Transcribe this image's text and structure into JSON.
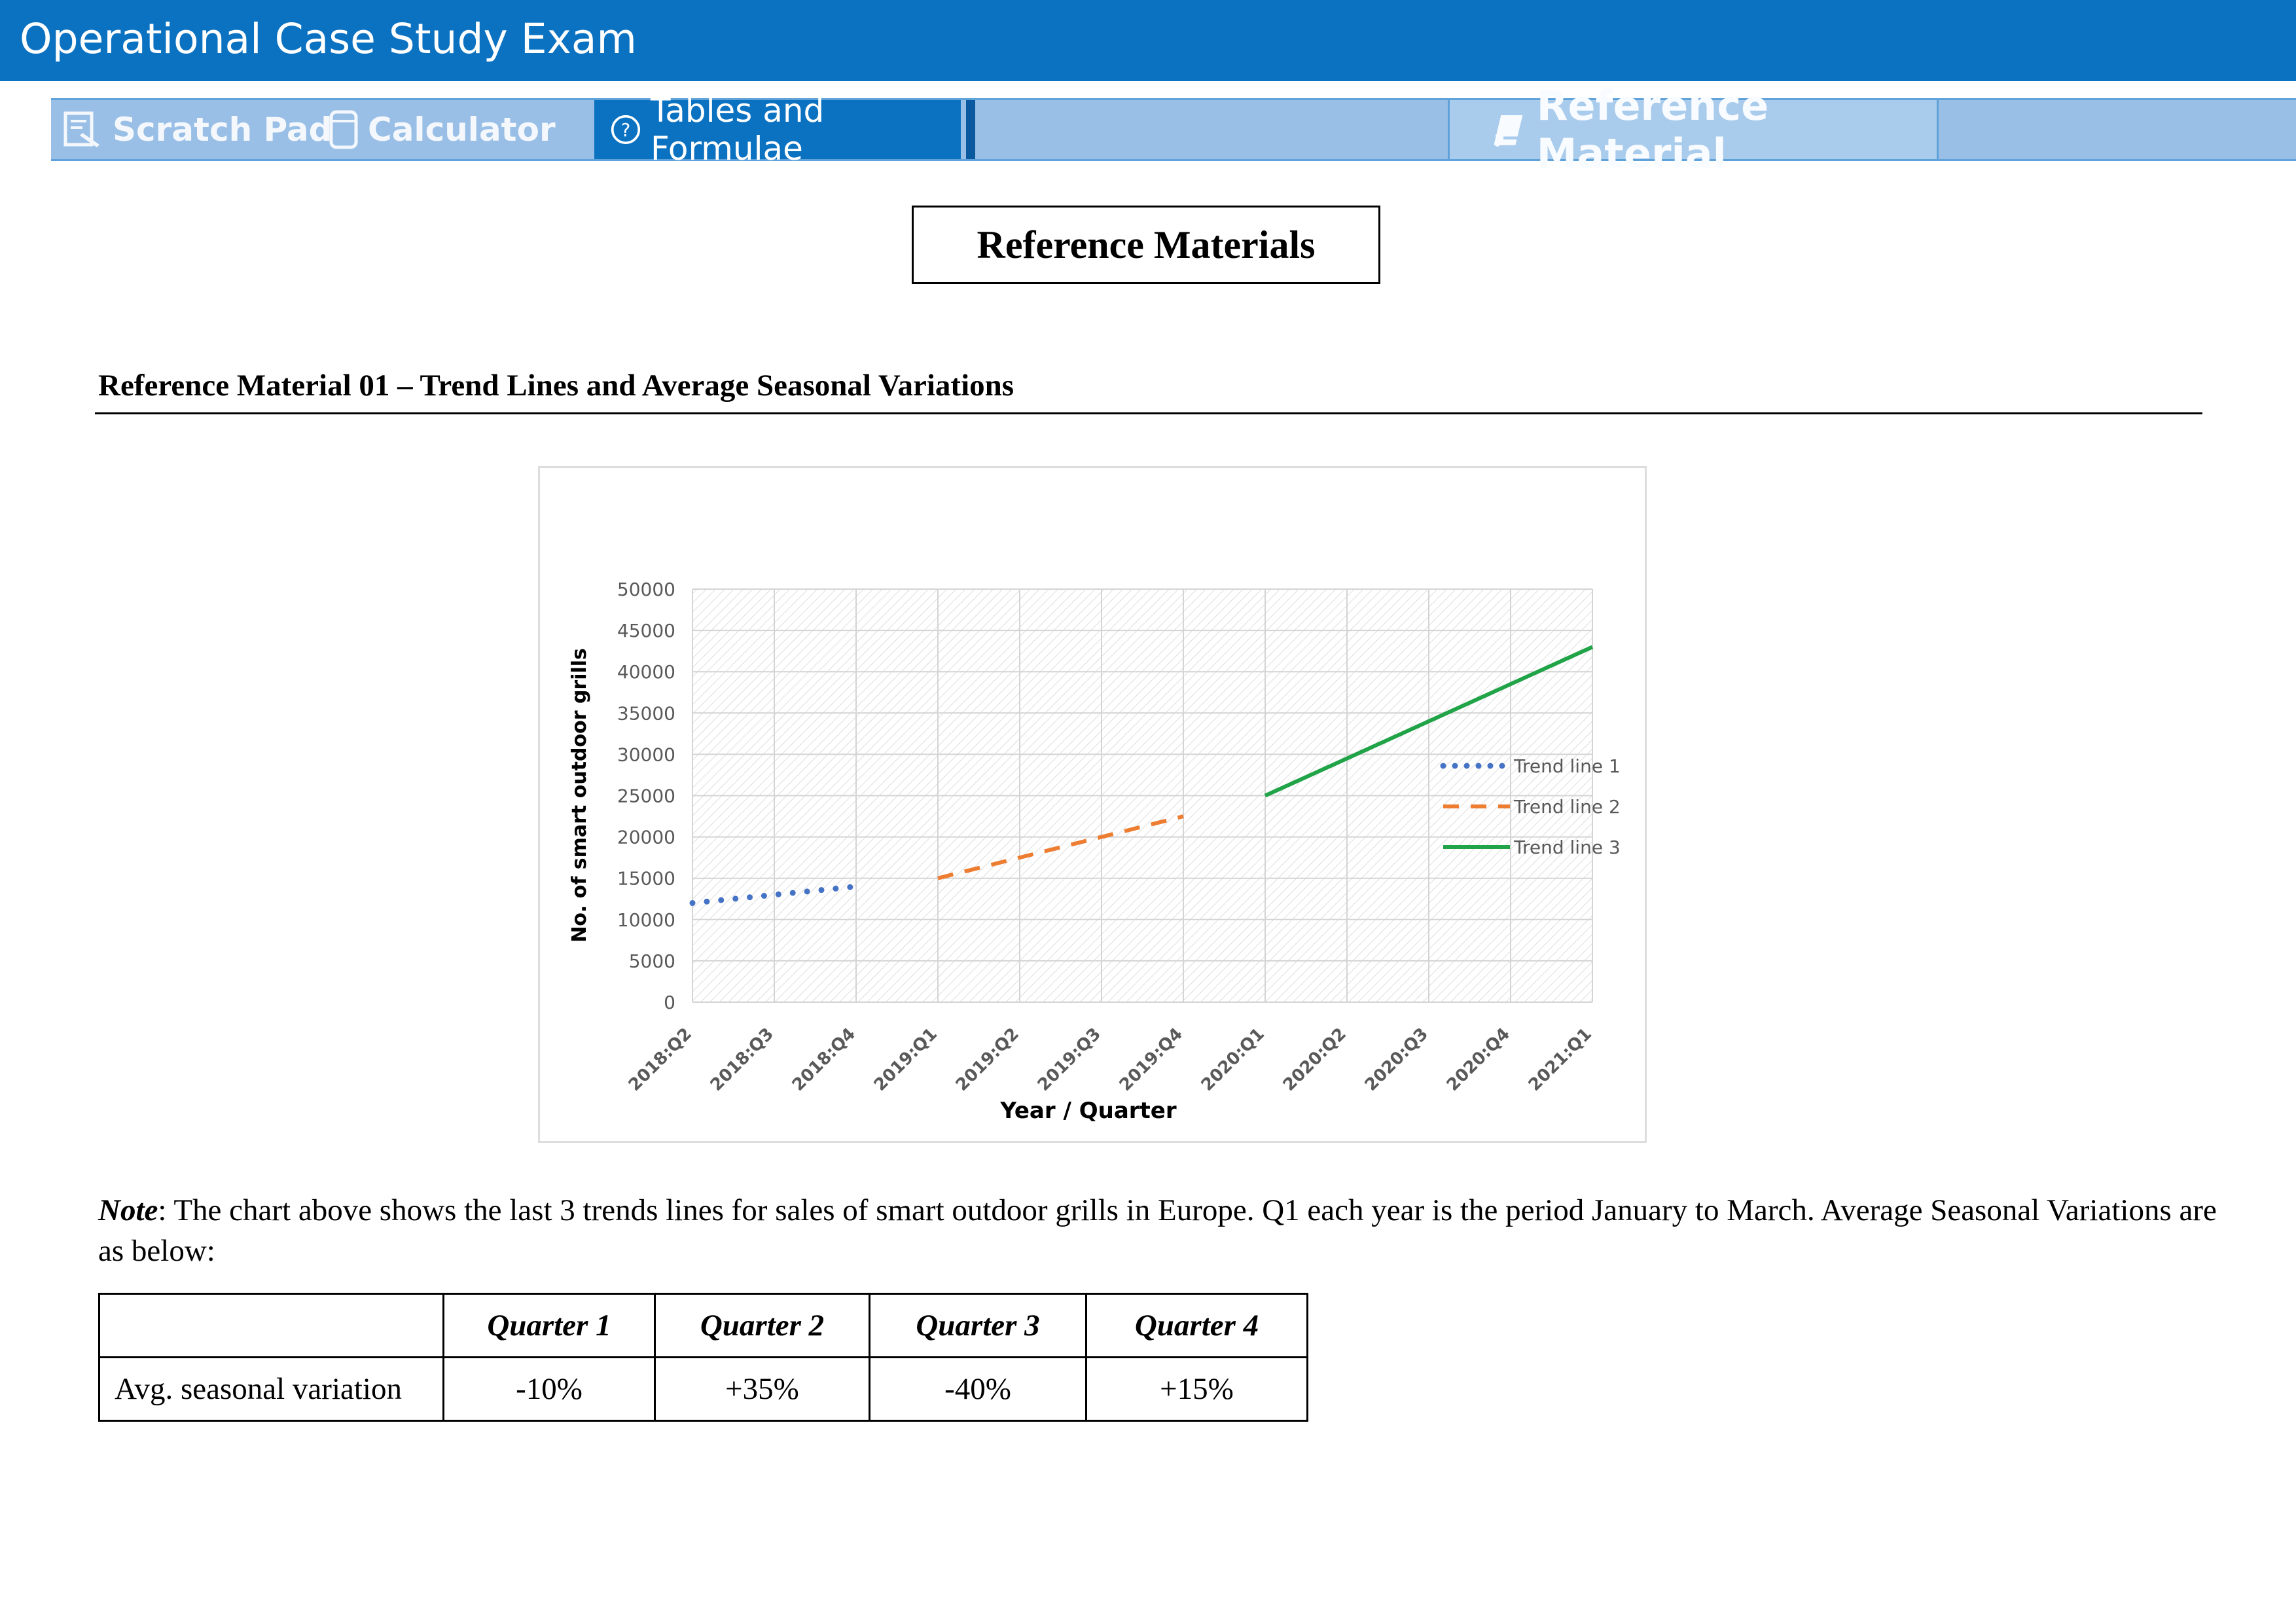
{
  "window": {
    "title": "Operational Case Study Exam"
  },
  "toolbar": {
    "scratch_pad": "Scratch Pad",
    "calculator": "Calculator",
    "tables_formulae": "Tables and Formulae",
    "reference_material": "Reference Material"
  },
  "page": {
    "heading": "Reference Materials",
    "section_title": "Reference Material 01 – Trend Lines and Average Seasonal Variations",
    "note_label": "Note",
    "note_text": ": The chart above shows the last 3 trends lines for sales of smart outdoor grills in Europe. Q1 each year is the period January to March. Average Seasonal Variations are as below:"
  },
  "table": {
    "headers": [
      "",
      "Quarter 1",
      "Quarter 2",
      "Quarter 3",
      "Quarter 4"
    ],
    "rows": [
      {
        "label": "Avg. seasonal variation",
        "values": [
          "-10%",
          "+35%",
          "-40%",
          "+15%"
        ]
      }
    ]
  },
  "chart_data": {
    "type": "line",
    "title": "",
    "xlabel": "Year / Quarter",
    "ylabel": "No. of smart outdoor grills",
    "categories": [
      "2018:Q2",
      "2018:Q3",
      "2018:Q4",
      "2019:Q1",
      "2019:Q2",
      "2019:Q3",
      "2019:Q4",
      "2020:Q1",
      "2020:Q2",
      "2020:Q3",
      "2020:Q4",
      "2021:Q1"
    ],
    "yticks": [
      0,
      5000,
      10000,
      15000,
      20000,
      25000,
      30000,
      35000,
      40000,
      45000,
      50000
    ],
    "ylim": [
      0,
      50000
    ],
    "grid": true,
    "legend_position": "right",
    "series": [
      {
        "name": "Trend line 1",
        "style": "dotted",
        "color": "#4472c4",
        "x": [
          "2018:Q2",
          "2018:Q4"
        ],
        "y": [
          12000,
          14000
        ]
      },
      {
        "name": "Trend line 2",
        "style": "dashed",
        "color": "#ed7d31",
        "x": [
          "2019:Q1",
          "2019:Q4"
        ],
        "y": [
          15000,
          22500
        ]
      },
      {
        "name": "Trend line 3",
        "style": "solid",
        "color": "#21a348",
        "x": [
          "2020:Q1",
          "2021:Q1"
        ],
        "y": [
          25000,
          43000
        ]
      }
    ]
  }
}
